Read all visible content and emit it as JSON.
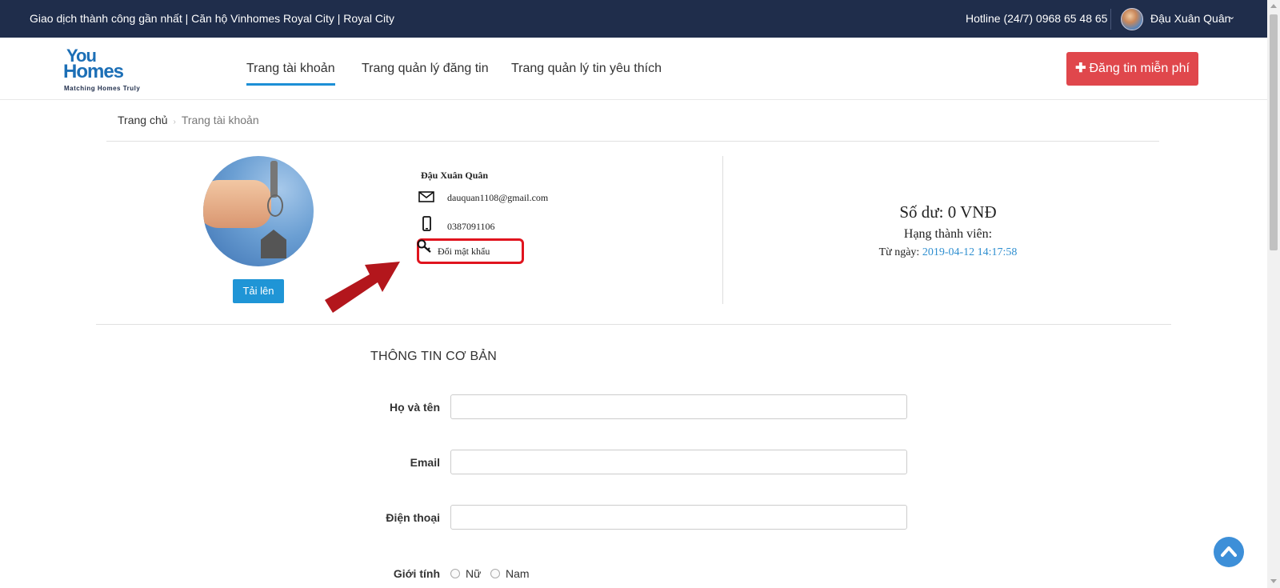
{
  "topbar": {
    "recent_deal": "Giao dịch thành công gần nhất | Căn hộ Vinhomes Royal City | Royal City",
    "hotline": "Hotline (24/7) 0968 65 48 65",
    "user_name": "Đậu Xuân Quân"
  },
  "logo": {
    "line1": "You",
    "line2": "Homes",
    "tagline": "Matching Homes Truly"
  },
  "nav": {
    "items": [
      {
        "label": "Trang tài khoản",
        "active": true
      },
      {
        "label": "Trang quản lý đăng tin",
        "active": false
      },
      {
        "label": "Trang quản lý tin yêu thích",
        "active": false
      }
    ],
    "post_button": "Đăng tin miễn phí"
  },
  "breadcrumb": {
    "home": "Trang chủ",
    "current": "Trang tài khoản"
  },
  "profile": {
    "upload_button": "Tải lên",
    "name": "Đậu Xuân Quân",
    "email": "dauquan1108@gmail.com",
    "phone": "0387091106",
    "change_password": "Đổi mật khẩu",
    "highlight_color": "#e0141e"
  },
  "account": {
    "balance": "Số dư: 0 VNĐ",
    "member_rank": "Hạng thành viên:",
    "since_label": "Từ ngày:",
    "since_date": "2019-04-12 14:17:58"
  },
  "form": {
    "section_title": "THÔNG TIN CƠ BẢN",
    "fields": [
      {
        "label": "Họ và tên",
        "value": ""
      },
      {
        "label": "Email",
        "value": ""
      },
      {
        "label": "Điện thoại",
        "value": ""
      }
    ],
    "gender_label": "Giới tính",
    "gender_options": [
      "Nữ",
      "Nam"
    ]
  },
  "colors": {
    "topbar_bg": "#1f2d4b",
    "accent": "#1f95d6",
    "post_button": "#e0474c",
    "date_link": "#2f8fd0"
  }
}
